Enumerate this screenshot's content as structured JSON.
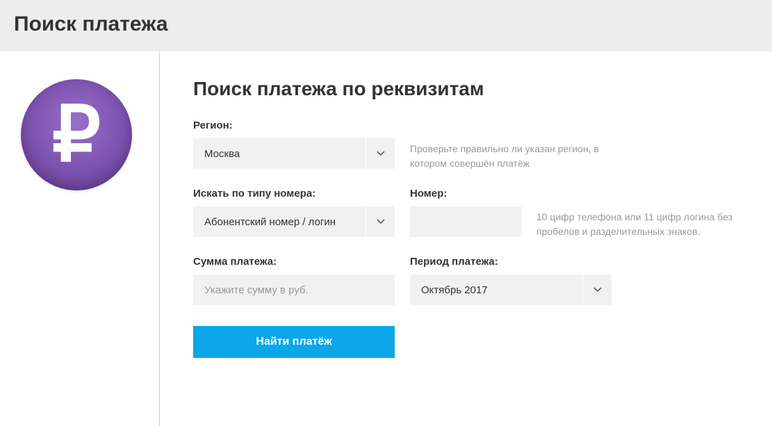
{
  "header": {
    "title": "Поиск платежа"
  },
  "section": {
    "title": "Поиск платежа по реквизитам"
  },
  "form": {
    "region": {
      "label": "Регион:",
      "value": "Москва",
      "hint": "Проверьте правильно ли указан регион, в котором совершён платёж"
    },
    "search_type": {
      "label": "Искать по типу номера:",
      "value": "Абонентский номер / логин"
    },
    "number": {
      "label": "Номер:",
      "value": "",
      "hint": "10 цифр телефона или 11 цифр логина без пробелов и разделительных знаков."
    },
    "amount": {
      "label": "Сумма платежа:",
      "placeholder": "Укажите сумму в руб.",
      "value": ""
    },
    "period": {
      "label": "Период платежа:",
      "value": "Октябрь 2017"
    },
    "submit_label": "Найти платёж"
  },
  "icon": {
    "ruble": "₽"
  }
}
